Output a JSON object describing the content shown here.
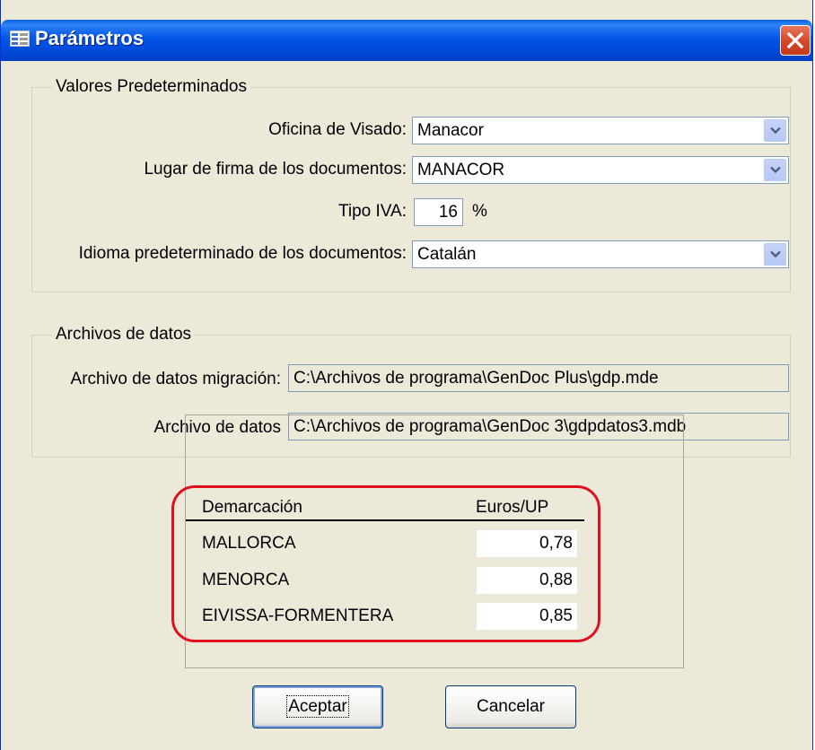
{
  "window": {
    "title": "Parámetros"
  },
  "defaults": {
    "legend": "Valores Predeterminados",
    "office": {
      "label": "Oficina de Visado:",
      "value": "Manacor"
    },
    "place": {
      "label": "Lugar de firma de los documentos:",
      "value": "MANACOR"
    },
    "vat": {
      "label": "Tipo IVA:",
      "value": "16",
      "unit": "%"
    },
    "language": {
      "label": "Idioma predeterminado de los documentos:",
      "value": "Catalán"
    }
  },
  "datafiles": {
    "legend": "Archivos de datos",
    "migration": {
      "label": "Archivo de datos migración:",
      "value": "C:\\Archivos de programa\\GenDoc Plus\\gdp.mde"
    },
    "data": {
      "label": "Archivo de datos",
      "value": "C:\\Archivos de programa\\GenDoc 3\\gdpdatos3.mdb"
    }
  },
  "rates": {
    "headers": {
      "name": "Demarcación",
      "value": "Euros/UP"
    },
    "rows": [
      {
        "name": "MALLORCA",
        "value": "0,78"
      },
      {
        "name": "MENORCA",
        "value": "0,88"
      },
      {
        "name": "EIVISSA-FORMENTERA",
        "value": "0,85"
      }
    ]
  },
  "buttons": {
    "ok": "Aceptar",
    "cancel": "Cancelar"
  },
  "colors": {
    "title_bar": "#0055e5",
    "window_bg": "#ece9d8",
    "highlight": "#e0101e"
  },
  "icons": {
    "title": "form-icon",
    "close": "close-icon",
    "dropdown": "chevron-down-icon"
  }
}
